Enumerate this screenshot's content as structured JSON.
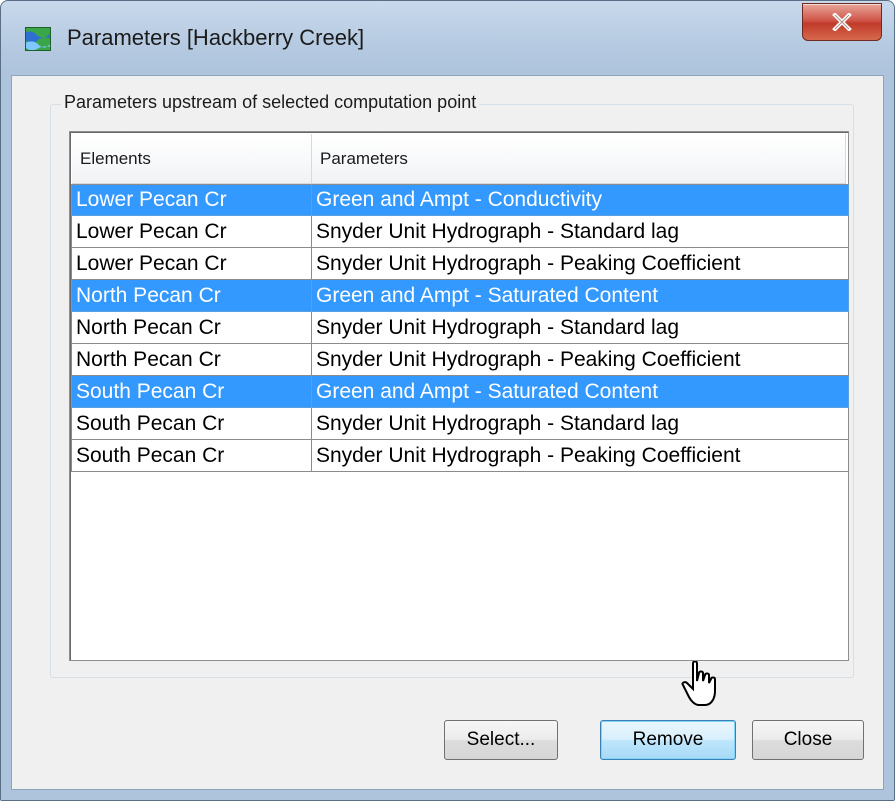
{
  "window": {
    "title": "Parameters [Hackberry Creek]",
    "close_glyph": "X"
  },
  "group": {
    "legend": "Parameters upstream of selected computation point"
  },
  "table": {
    "headers": [
      "Elements",
      "Parameters"
    ],
    "rows": [
      {
        "element": "Lower Pecan Cr",
        "parameter": "Green and Ampt - Conductivity",
        "selected": true
      },
      {
        "element": "Lower Pecan Cr",
        "parameter": "Snyder Unit Hydrograph - Standard lag",
        "selected": false
      },
      {
        "element": "Lower Pecan Cr",
        "parameter": "Snyder Unit Hydrograph - Peaking Coefficient",
        "selected": false
      },
      {
        "element": "North Pecan Cr",
        "parameter": "Green and Ampt - Saturated Content",
        "selected": true
      },
      {
        "element": "North Pecan Cr",
        "parameter": "Snyder Unit Hydrograph - Standard lag",
        "selected": false
      },
      {
        "element": "North Pecan Cr",
        "parameter": "Snyder Unit Hydrograph - Peaking Coefficient",
        "selected": false
      },
      {
        "element": "South Pecan Cr",
        "parameter": "Green and Ampt - Saturated Content",
        "selected": true
      },
      {
        "element": "South Pecan Cr",
        "parameter": "Snyder Unit Hydrograph - Standard lag",
        "selected": false
      },
      {
        "element": "South Pecan Cr",
        "parameter": "Snyder Unit Hydrograph - Peaking Coefficient",
        "selected": false
      }
    ]
  },
  "buttons": {
    "select_label": "Select...",
    "remove_label": "Remove",
    "close_label": "Close"
  },
  "colors": {
    "selection": "#3399ff",
    "title_close": "#c13a2a"
  },
  "icons": {
    "app": "hec-hms-watershed-icon",
    "close": "close-icon",
    "cursor": "mouse-pointer-icon"
  }
}
